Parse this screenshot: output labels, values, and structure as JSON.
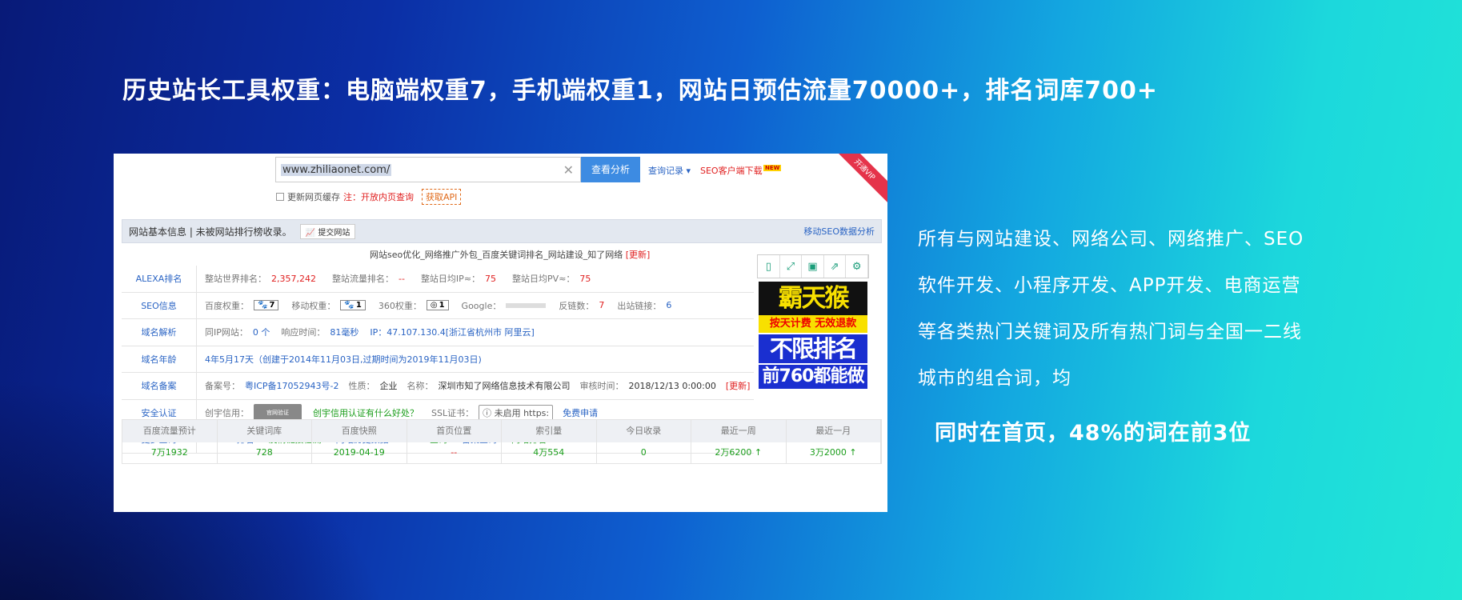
{
  "headline": "历史站长工具权重：电脑端权重7，手机端权重1，网站日预估流量70000+，排名词库700+",
  "search": {
    "value": "www.zhiliaonet.com/",
    "button": "查看分析",
    "history": "查询记录",
    "client": "SEO客户端下载",
    "new": "NEW",
    "vip": "开通VIP",
    "cache": "更新网页缓存",
    "cache_note": "注：开放内页查询",
    "api": "获取API"
  },
  "bar": {
    "title": "网站基本信息 | 未被网站排行榜收录。",
    "submit": "提交网站",
    "mobile": "移动SEO数据分析"
  },
  "site_desc": "网站seo优化_网络推广外包_百度关键词排名_网站建设_知了网络",
  "update": "[更新]",
  "alexa": {
    "label": "ALEXA排名",
    "world_lab": "整站世界排名：",
    "world": "2,357,242",
    "flow_lab": "整站流量排名：",
    "flow": "--",
    "ip_lab": "整站日均IP≈：",
    "ip": "75",
    "pv_lab": "整站日均PV≈：",
    "pv": "75"
  },
  "seo": {
    "label": "SEO信息",
    "bd_lab": "百度权重：",
    "bd": "7",
    "mob_lab": "移动权重：",
    "mob": "1",
    "s360_lab": "360权重：",
    "s360": "1",
    "google_lab": "Google：",
    "back_lab": "反链数：",
    "back": "7",
    "out_lab": "出站链接：",
    "out": "6"
  },
  "dns": {
    "label": "域名解析",
    "sameip_lab": "同IP网站：",
    "sameip": "0 个",
    "resp_lab": "响应时间：",
    "resp": "81毫秒",
    "ip": "IP：47.107.130.4[浙江省杭州市 阿里云]"
  },
  "age": {
    "label": "域名年龄",
    "value": "4年5月17天（创建于2014年11月03日,过期时间为2019年11月03日)"
  },
  "beian": {
    "label": "域名备案",
    "no_lab": "备案号：",
    "no": "粤ICP备17052943号-2",
    "type_lab": "性质：",
    "type": "企业",
    "name_lab": "名称：",
    "name": "深圳市知了网络信息技术有限公司",
    "time_lab": "审核时间：",
    "time": "2018/12/13 0:00:00",
    "update": "[更新]"
  },
  "security": {
    "label": "安全认证",
    "credit_lab": "创宇信用：",
    "cred_img": "官网验证",
    "credit_link": "创宇信用认证有什么好处？",
    "ssl_lab": "SSL证书：",
    "ssl": "未启用 https:",
    "free": "免费申请"
  },
  "more": {
    "label": "更多查询",
    "links": [
      "ALEXA排名",
      "友情链接检测",
      "网站历史数据",
      "Whois查询",
      "备案查询",
      "网站排名"
    ]
  },
  "ad": {
    "l1": "霸天猴",
    "l2": "按天计费 无效退款",
    "l3": "不限排名",
    "l4": "前760都能做"
  },
  "stats": {
    "headers": [
      "百度流量预计",
      "关键词库",
      "百度快照",
      "首页位置",
      "索引量",
      "今日收录",
      "最近一周",
      "最近一月"
    ],
    "values": [
      "7万1932",
      "728",
      "2019-04-19",
      "--",
      "4万554",
      "0",
      "2万6200 ↑",
      "3万2000 ↑"
    ]
  },
  "side": {
    "l1": "所有与网站建设、网络公司、网络推广、SEO",
    "l2": "软件开发、小程序开发、APP开发、电商运营",
    "l3": "等各类热门关键词及所有热门词与全国一二线",
    "l4": "城市的组合词，均",
    "hl": "同时在首页，48%的词在前3位"
  }
}
